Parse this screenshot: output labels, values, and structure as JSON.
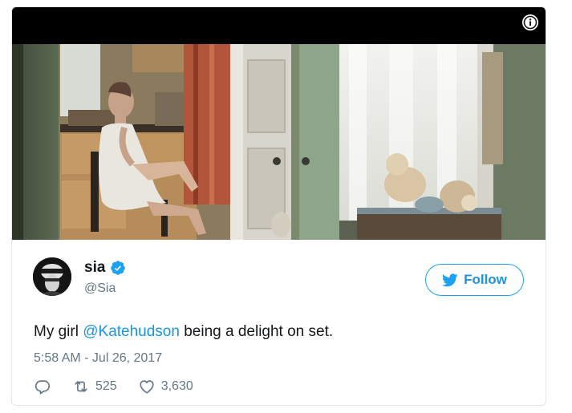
{
  "video": {
    "info_icon": "info-icon",
    "frame_description_icon": "video-frame"
  },
  "author": {
    "name": "sia",
    "handle": "@Sia",
    "verified_icon": "verified-badge-icon",
    "avatar_icon": "avatar"
  },
  "follow": {
    "label": "Follow",
    "icon": "twitter-bird-icon"
  },
  "tweet": {
    "text_before": "My girl ",
    "mention": "@Katehudson",
    "text_after": " being a delight on set.",
    "timestamp": "5:58 AM - Jul 26, 2017"
  },
  "actions": {
    "reply_icon": "reply-icon",
    "retweet_icon": "retweet-icon",
    "retweet_count": "525",
    "like_icon": "heart-icon",
    "like_count": "3,630"
  },
  "colors": {
    "link_blue": "#1b95e0",
    "follow_border": "#1da1f2",
    "secondary_text": "#657786",
    "verified_blue": "#1da1f2"
  }
}
